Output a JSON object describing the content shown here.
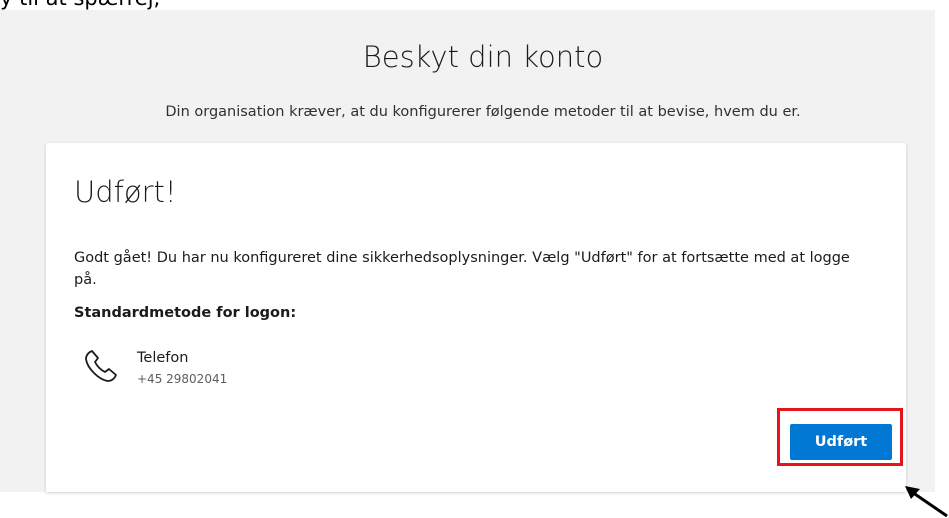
{
  "top_snippet": "y til at spærrej,",
  "header": {
    "title": "Beskyt din konto",
    "subtitle": "Din organisation kræver, at du konfigurerer følgende metoder til at bevise, hvem du er."
  },
  "card": {
    "title": "Udført!",
    "message": "Godt gået! Du har nu konfigureret dine sikkerhedsoplysninger. Vælg \"Udført\" for at fortsætte med at logge på.",
    "default_method_label": "Standardmetode for logon:",
    "method": {
      "icon": "phone-icon",
      "name": "Telefon",
      "value": "+45 29802041"
    },
    "done_button_label": "Udført"
  },
  "annotations": {
    "highlight_color": "#e8141c",
    "arrow_color": "#000000"
  },
  "colors": {
    "accent": "#0078d4",
    "page_background": "#f2f2f2"
  }
}
